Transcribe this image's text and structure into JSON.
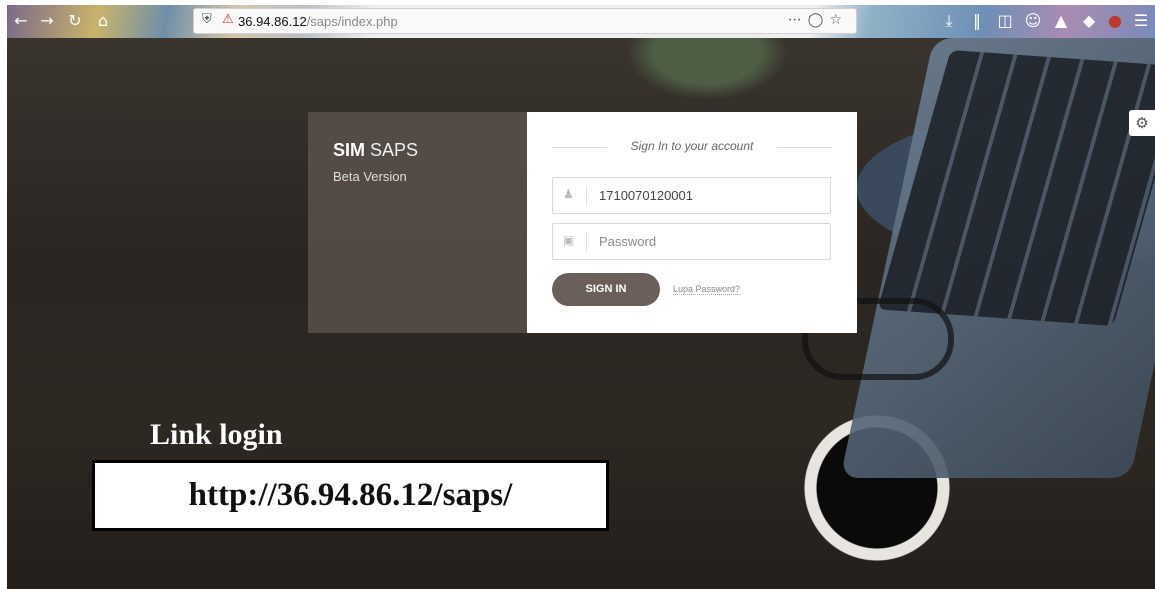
{
  "browser": {
    "url_host": "36.94.86.12",
    "url_path": "/saps/index.php",
    "nav_icons": [
      "back-icon",
      "forward-icon",
      "reload-icon",
      "home-icon"
    ],
    "toolbar_icons": [
      "download-icon",
      "library-icon",
      "sidebar-icon",
      "account-icon",
      "extension-icon",
      "extension-icon",
      "ublock-icon",
      "menu-icon"
    ]
  },
  "brand": {
    "name_bold": "SIM",
    "name_light": "SAPS",
    "subtitle": "Beta Version"
  },
  "form": {
    "heading": "Sign In to your account",
    "username_value": "1710070120001",
    "password_placeholder": "Password",
    "signin_label": "SIGN IN",
    "forgot_label": "Lupa Password?"
  },
  "annotation": {
    "label": "Link login",
    "url": "http://36.94.86.12/saps/"
  },
  "colors": {
    "button": "#6b5f5b",
    "brand_panel": "#5f5550"
  }
}
